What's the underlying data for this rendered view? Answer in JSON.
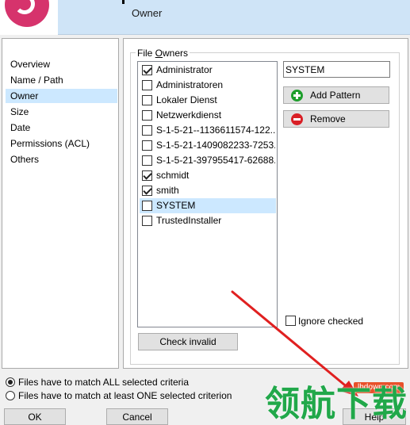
{
  "header": {
    "title": "Owner"
  },
  "nav": {
    "items": [
      {
        "label": "Overview",
        "selected": false
      },
      {
        "label": "Name / Path",
        "selected": false
      },
      {
        "label": "Owner",
        "selected": true
      },
      {
        "label": "Size",
        "selected": false
      },
      {
        "label": "Date",
        "selected": false
      },
      {
        "label": "Permissions (ACL)",
        "selected": false
      },
      {
        "label": "Others",
        "selected": false
      }
    ]
  },
  "owners": {
    "group_label_pre": "File ",
    "group_label_accel": "O",
    "group_label_post": "wners",
    "items": [
      {
        "label": "Administrator",
        "checked": true,
        "selected": false
      },
      {
        "label": "Administratoren",
        "checked": false,
        "selected": false
      },
      {
        "label": "Lokaler Dienst",
        "checked": false,
        "selected": false
      },
      {
        "label": "Netzwerkdienst",
        "checked": false,
        "selected": false
      },
      {
        "label": "S-1-5-21--1136611574-122...",
        "checked": false,
        "selected": false
      },
      {
        "label": "S-1-5-21-1409082233-7253...",
        "checked": false,
        "selected": false
      },
      {
        "label": "S-1-5-21-397955417-62688...",
        "checked": false,
        "selected": false
      },
      {
        "label": "schmidt",
        "checked": true,
        "selected": false
      },
      {
        "label": "smith",
        "checked": true,
        "selected": false
      },
      {
        "label": "SYSTEM",
        "checked": false,
        "selected": true
      },
      {
        "label": "TrustedInstaller",
        "checked": false,
        "selected": false
      }
    ],
    "pattern_value": "SYSTEM",
    "add_pattern_label": "Add Pattern",
    "remove_label": "Remove",
    "ignore_checked_label": "Ignore checked",
    "check_invalid_label": "Check invalid"
  },
  "match": {
    "all_label": "Files have to match ALL selected criteria",
    "one_label": "Files have to match at least ONE selected criterion",
    "selected": "all"
  },
  "footer": {
    "ok_label": "OK",
    "cancel_label": "Cancel",
    "help_label": "Help"
  },
  "watermark": {
    "site": "lhdown.com",
    "text": "领航下载"
  },
  "colors": {
    "header_bg": "#cfe4f7",
    "selection": "#cce8ff",
    "logo": "#d6336c",
    "arrow": "#e02020",
    "watermark_green": "#21a84a"
  }
}
